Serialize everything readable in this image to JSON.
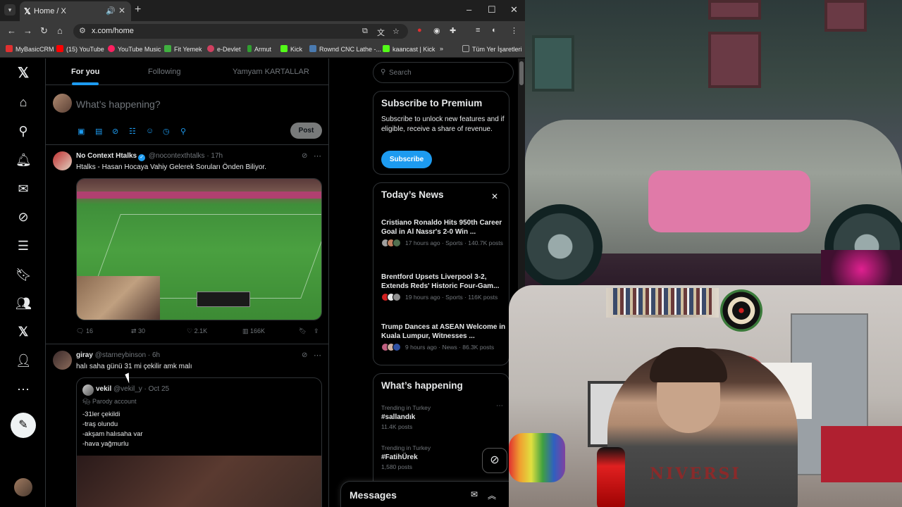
{
  "browser": {
    "tab_title": "Home / X",
    "url": "x.com/home",
    "bookmarks": [
      "MyBasicCRM",
      "(15) YouTube",
      "YouTube Music",
      "Fit Yemek",
      "e-Devlet",
      "Armut",
      "Kick",
      "Rownd CNC Lathe -...",
      "kaancast | Kick",
      "Tüm Yer İşaretleri"
    ],
    "bookmark_colors": [
      "#e03030",
      "#ff0000",
      "#ff2060",
      "#40b040",
      "#d04060",
      "#30a030",
      "#53fc18",
      "#4a7ab0",
      "#53fc18",
      "#aaaaaa"
    ]
  },
  "feed": {
    "tabs": [
      "For you",
      "Following",
      "Yamyam KARTALLAR"
    ],
    "composer_placeholder": "What’s happening?",
    "post_label": "Post",
    "tweets": [
      {
        "name": "No Context Htalks",
        "handle": "@nocontexthtalks · 17h",
        "text": "Htalks - Hasan Hocaya Vahiy Gelerek Soruları Önden Biliyor.",
        "replies": "16",
        "reposts": "30",
        "likes": "2.1K",
        "views": "166K"
      },
      {
        "name": "giray",
        "handle": "@starneybinson · 6h",
        "text": "halı saha günü 31 mi çekilir amk malı",
        "quote": {
          "name": "vekil",
          "handle": "@vekil_y · Oct 25",
          "label": "Parody account",
          "lines": [
            "-31ler çekildi",
            "-traş olundu",
            "-akşam halısaha var",
            "-hava yağmurlu"
          ]
        }
      }
    ]
  },
  "sidebar": {
    "search_placeholder": "Search",
    "premium": {
      "title": "Subscribe to Premium",
      "desc": "Subscribe to unlock new features and if eligible, receive a share of revenue.",
      "button": "Subscribe"
    },
    "news_title": "Today’s News",
    "news": [
      {
        "title": "Cristiano Ronaldo Hits 950th Career Goal in Al Nassr's 2-0 Win ...",
        "meta": "17 hours ago · Sports · 140.7K posts"
      },
      {
        "title": "Brentford Upsets Liverpool 3-2, Extends Reds' Historic Four-Gam...",
        "meta": "19 hours ago · Sports · 116K posts"
      },
      {
        "title": "Trump Dances at ASEAN Welcome in Kuala Lumpur, Witnesses ...",
        "meta": "9 hours ago · News · 86.3K posts"
      }
    ],
    "happening_title": "What’s happening",
    "trends": [
      {
        "label": "Trending in Turkey",
        "name": "#sallandık",
        "count": "11.4K posts"
      },
      {
        "label": "Trending in Turkey",
        "name": "#FatihÜrek",
        "count": "1,580 posts"
      }
    ]
  },
  "messages": {
    "title": "Messages"
  },
  "webcam": {
    "shirt_text": "NIVERSI"
  }
}
